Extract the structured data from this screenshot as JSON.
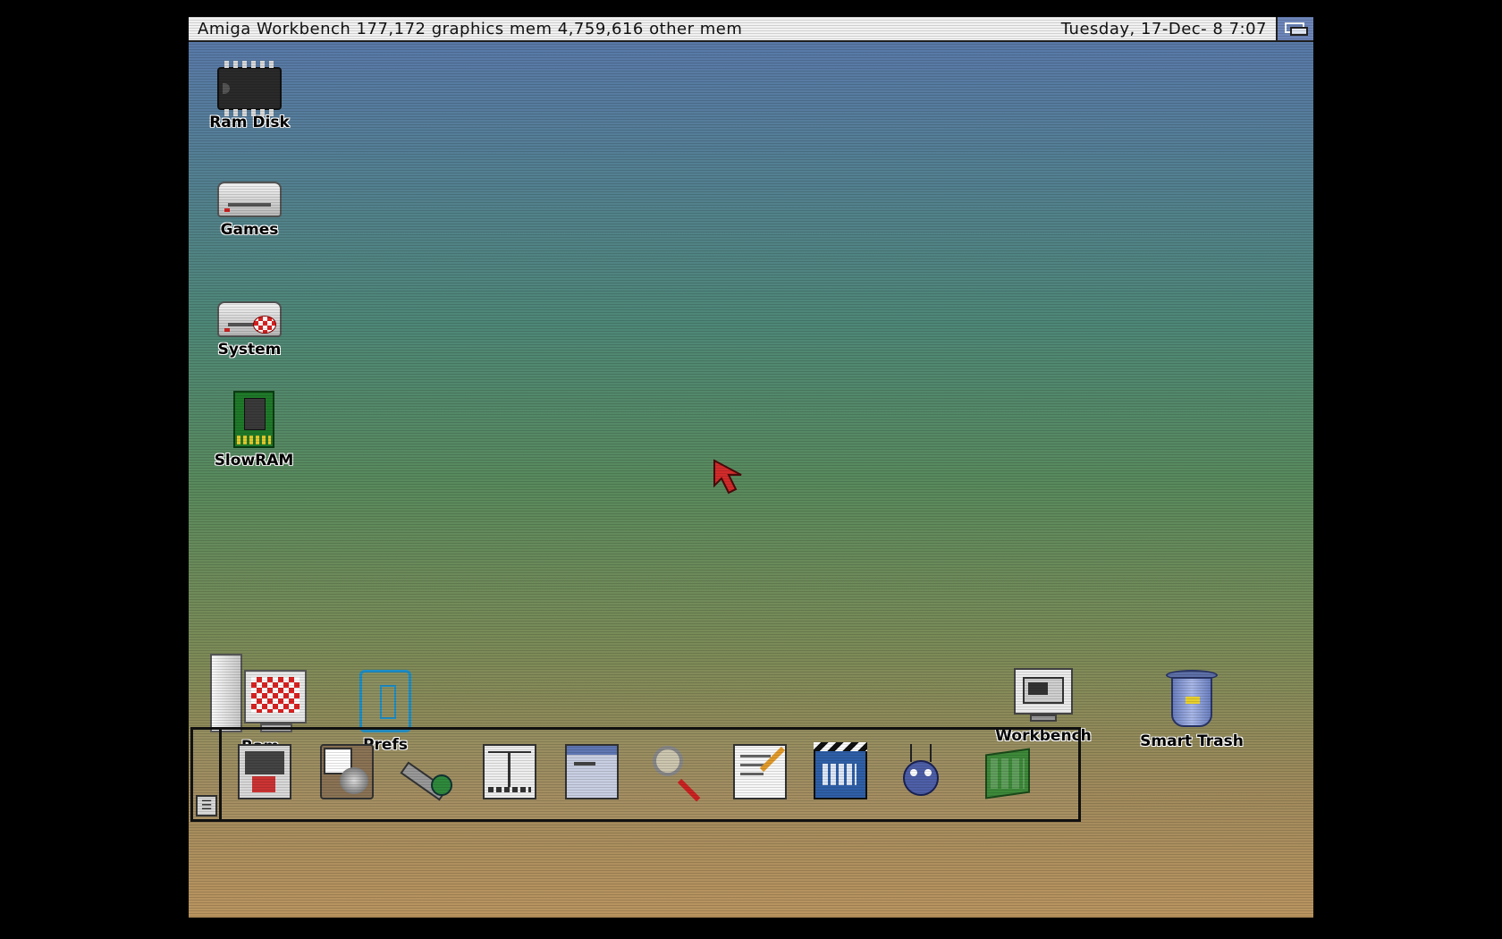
{
  "screen": {
    "title_left": "Amiga Workbench  177,172 graphics mem  4,759,616 other mem",
    "title_right": "Tuesday, 17-Dec-   8   7:07"
  },
  "desktop_icons": {
    "ram_disk": "Ram Disk",
    "games": "Games",
    "system": "System",
    "slowram": "SlowRAM",
    "ram": "Ram",
    "prefs": "Prefs",
    "workbench": "Workbench",
    "trash": "Smart Trash"
  },
  "dock": {
    "handle_glyph": "☰",
    "items": [
      {
        "name": "dock-item-shell"
      },
      {
        "name": "dock-item-multiview"
      },
      {
        "name": "dock-item-flashlight"
      },
      {
        "name": "dock-item-filemanager"
      },
      {
        "name": "dock-item-window"
      },
      {
        "name": "dock-item-search"
      },
      {
        "name": "dock-item-editor"
      },
      {
        "name": "dock-item-player"
      },
      {
        "name": "dock-item-bug"
      },
      {
        "name": "dock-item-blocks"
      }
    ]
  },
  "colors": {
    "titlebar": "#f2f2f2",
    "gradient_top": "#5a78ad",
    "gradient_mid": "#4e8777",
    "gradient_bottom": "#ba9560",
    "pointer": "#d32b2b"
  }
}
